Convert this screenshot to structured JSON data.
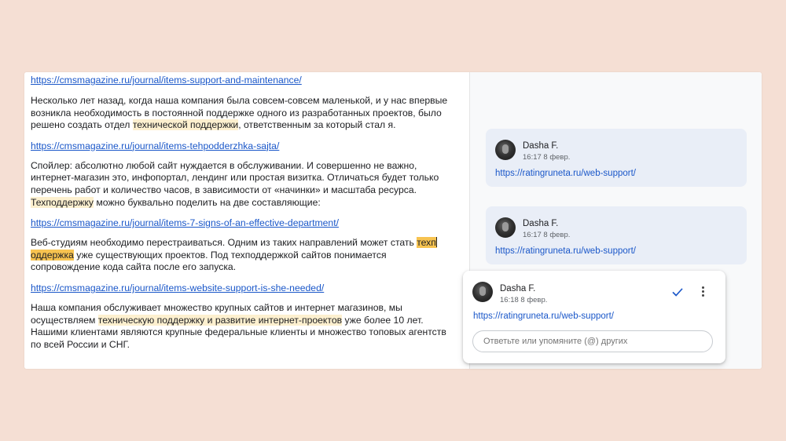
{
  "document": {
    "link1": "https://cmsmagazine.ru/journal/items-support-and-maintenance/",
    "p1": {
      "a": "Несколько лет назад, когда наша компания была совсем-совсем маленькой, и у нас впервые возникла необходимость в постоянной поддержке одного из разработанных проектов, было решено создать отдел ",
      "hl": "технической поддержки",
      "b": ", ответственным за который стал я."
    },
    "link2": "https://cmsmagazine.ru/journal/items-tehpodderzhka-sajta/",
    "p2": {
      "a": "Спойлер: абсолютно любой сайт нуждается в обслуживании. И совершенно не важно, интернет-магазин это, инфопортал, лендинг или простая визитка. Отличаться будет только перечень работ и количество часов, в зависимости от «начинки» и масштаба ресурса. ",
      "hl": "Техподдержку",
      "b": " можно буквально поделить на две составляющие:"
    },
    "link3": "https://cmsmagazine.ru/journal/items-7-signs-of-an-effective-department/",
    "p3": {
      "a": "Веб-студиям необходимо перестраиваться. Одним из таких направлений может стать ",
      "hl1": "техп",
      "hl2": "оддержка",
      "b": " уже существующих проектов. Под техподдержкой сайтов понимается сопровождение кода сайта после его запуска."
    },
    "link4": "https://cmsmagazine.ru/journal/items-website-support-is-she-needed/",
    "p4": {
      "a": "Наша компания обслуживает множество крупных сайтов и интернет магазинов, мы осуществляем ",
      "hl": "техническую поддержку и развитие интернет-проектов",
      "b": " уже более 10 лет. Нашими клиентами являются крупные федеральные клиенты и множество топовых агентств по всей России и СНГ."
    }
  },
  "comments": [
    {
      "author": "Dasha F.",
      "time": "16:17 8 февр.",
      "link": "https://ratingruneta.ru/web-support/"
    },
    {
      "author": "Dasha F.",
      "time": "16:17 8 февр.",
      "link": "https://ratingruneta.ru/web-support/"
    }
  ],
  "active_comment": {
    "author": "Dasha F.",
    "time": "16:18 8 февр.",
    "link": "https://ratingruneta.ru/web-support/",
    "reply_placeholder": "Ответьте или упомяните (@) других"
  },
  "colors": {
    "background": "#f5dfd4",
    "link": "#1a57c9",
    "highlight": "#fdf0cf",
    "highlight_active": "#f7c350",
    "comment_bg": "#e9eef7"
  },
  "icons": [
    "avatar",
    "check-icon",
    "more-vert-icon"
  ]
}
